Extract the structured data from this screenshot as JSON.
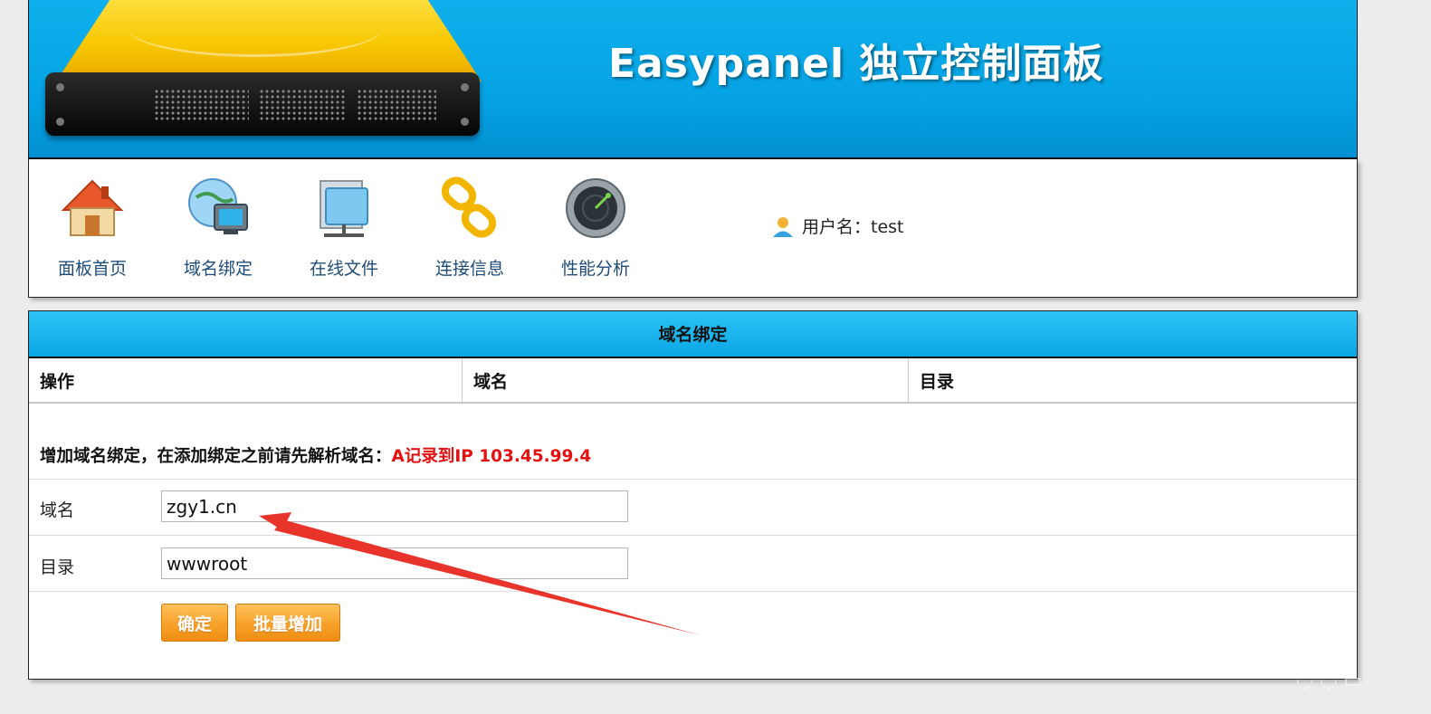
{
  "banner": {
    "title": "Easypanel 独立控制面板"
  },
  "nav": {
    "items": [
      {
        "label": "面板首页",
        "icon": "home-icon"
      },
      {
        "label": "域名绑定",
        "icon": "globe-monitor-icon"
      },
      {
        "label": "在线文件",
        "icon": "folder-network-icon"
      },
      {
        "label": "连接信息",
        "icon": "chain-link-icon"
      },
      {
        "label": "性能分析",
        "icon": "radar-gauge-icon"
      }
    ],
    "user_label": "用户名：test"
  },
  "panel": {
    "title": "域名绑定",
    "columns": [
      "操作",
      "域名",
      "目录"
    ],
    "notice": "增加域名绑定，在添加绑定之前请先解析域名：",
    "notice_highlight": "A记录到IP 103.45.99.4",
    "domain_label": "域名",
    "domain_value": "zgy1.cn",
    "dir_label": "目录",
    "dir_value": "wwwroot",
    "confirm_label": "确定",
    "batch_label": "批量增加"
  },
  "colors": {
    "banner": "#05a3e4",
    "button": "#f7a12a",
    "notice_red": "#e41010",
    "nav_text": "#1f4d78",
    "annotation_arrow": "#e8342a"
  }
}
